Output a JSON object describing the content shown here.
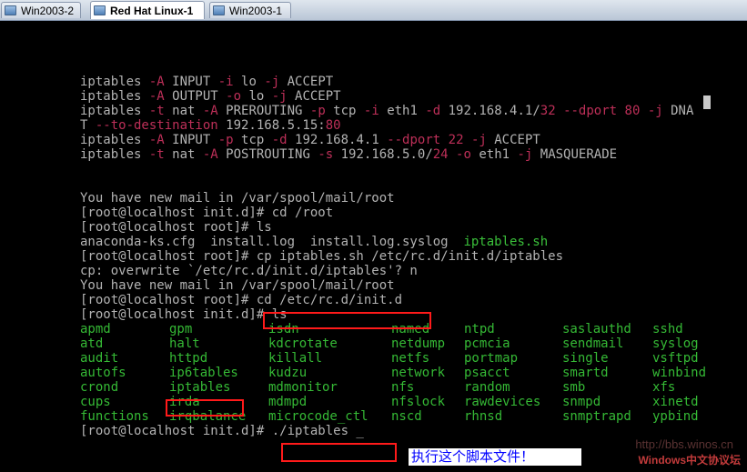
{
  "tabs": [
    {
      "label": "Win2003-2",
      "active": false
    },
    {
      "label": "Red Hat Linux-1",
      "active": true
    },
    {
      "label": "Win2003-1",
      "active": false
    }
  ],
  "colors": {
    "background": "#000000",
    "normal_text": "#b3b3b3",
    "option_text": "#bd2f58",
    "listing_text": "#35b935",
    "highlight_box": "#ff1a1a"
  },
  "terminal": {
    "lines": [
      [
        {
          "t": "iptables ",
          "c": ""
        },
        {
          "t": "-A",
          "c": "r"
        },
        {
          "t": " INPUT ",
          "c": ""
        },
        {
          "t": "-i",
          "c": "r"
        },
        {
          "t": " lo ",
          "c": ""
        },
        {
          "t": "-j",
          "c": "r"
        },
        {
          "t": " ACCEPT",
          "c": ""
        }
      ],
      [
        {
          "t": "iptables ",
          "c": ""
        },
        {
          "t": "-A",
          "c": "r"
        },
        {
          "t": " OUTPUT ",
          "c": ""
        },
        {
          "t": "-o",
          "c": "r"
        },
        {
          "t": " lo ",
          "c": ""
        },
        {
          "t": "-j",
          "c": "r"
        },
        {
          "t": " ACCEPT",
          "c": ""
        }
      ],
      [
        {
          "t": "iptables ",
          "c": ""
        },
        {
          "t": "-t",
          "c": "r"
        },
        {
          "t": " nat ",
          "c": ""
        },
        {
          "t": "-A",
          "c": "r"
        },
        {
          "t": " PREROUTING ",
          "c": ""
        },
        {
          "t": "-p",
          "c": "r"
        },
        {
          "t": " tcp ",
          "c": ""
        },
        {
          "t": "-i",
          "c": "r"
        },
        {
          "t": " eth1 ",
          "c": ""
        },
        {
          "t": "-d",
          "c": "r"
        },
        {
          "t": " 192.168.4.1/",
          "c": ""
        },
        {
          "t": "32",
          "c": "r"
        },
        {
          "t": " ",
          "c": ""
        },
        {
          "t": "--dport",
          "c": "r"
        },
        {
          "t": " ",
          "c": ""
        },
        {
          "t": "80",
          "c": "r"
        },
        {
          "t": " ",
          "c": ""
        },
        {
          "t": "-j",
          "c": "r"
        },
        {
          "t": " DNA",
          "c": ""
        }
      ],
      [
        {
          "t": "T ",
          "c": ""
        },
        {
          "t": "--to-destination",
          "c": "r"
        },
        {
          "t": " 192.168.5.15:",
          "c": ""
        },
        {
          "t": "80",
          "c": "r"
        }
      ],
      [
        {
          "t": "iptables ",
          "c": ""
        },
        {
          "t": "-A",
          "c": "r"
        },
        {
          "t": " INPUT ",
          "c": ""
        },
        {
          "t": "-p",
          "c": "r"
        },
        {
          "t": " tcp ",
          "c": ""
        },
        {
          "t": "-d",
          "c": "r"
        },
        {
          "t": " 192.168.4.1 ",
          "c": ""
        },
        {
          "t": "--dport",
          "c": "r"
        },
        {
          "t": " ",
          "c": ""
        },
        {
          "t": "22",
          "c": "r"
        },
        {
          "t": " ",
          "c": ""
        },
        {
          "t": "-j",
          "c": "r"
        },
        {
          "t": " ACCEPT",
          "c": ""
        }
      ],
      [
        {
          "t": "iptables ",
          "c": ""
        },
        {
          "t": "-t",
          "c": "r"
        },
        {
          "t": " nat ",
          "c": ""
        },
        {
          "t": "-A",
          "c": "r"
        },
        {
          "t": " POSTROUTING ",
          "c": ""
        },
        {
          "t": "-s",
          "c": "r"
        },
        {
          "t": " 192.168.5.0/",
          "c": ""
        },
        {
          "t": "24",
          "c": "r"
        },
        {
          "t": " ",
          "c": ""
        },
        {
          "t": "-o",
          "c": "r"
        },
        {
          "t": " eth1 ",
          "c": ""
        },
        {
          "t": "-j",
          "c": "r"
        },
        {
          "t": " MASQUERADE",
          "c": ""
        }
      ],
      [],
      [],
      [
        {
          "t": "You have new mail in /var/spool/mail/root",
          "c": ""
        }
      ],
      [
        {
          "t": "[root@localhost init.d]# cd /root",
          "c": ""
        }
      ],
      [
        {
          "t": "[root@localhost root]# ls",
          "c": ""
        }
      ],
      [
        {
          "t": "anaconda-ks.cfg  install.log  install.log.syslog  ",
          "c": ""
        },
        {
          "t": "iptables.sh",
          "c": "g"
        }
      ],
      [
        {
          "t": "[root@localhost root]# cp iptables.sh /etc/rc.d/init.d/iptables",
          "c": ""
        }
      ],
      [
        {
          "t": "cp: overwrite `/etc/rc.d/init.d/iptables'? n",
          "c": ""
        }
      ],
      [
        {
          "t": "You have new mail in /var/spool/mail/root",
          "c": ""
        }
      ],
      [
        {
          "t": "[root@localhost root]# cd /etc/rc.d/init.d",
          "c": ""
        }
      ],
      [
        {
          "t": "[root@localhost init.d]# ls",
          "c": ""
        }
      ],
      [],
      [],
      [],
      [],
      [],
      [],
      [],
      [
        {
          "t": "[root@localhost init.d]# ./iptables _",
          "c": ""
        }
      ]
    ],
    "ls_columns": [
      [
        "apmd",
        "atd",
        "audit",
        "autofs",
        "crond",
        "cups",
        "functions"
      ],
      [
        "gpm",
        "halt",
        "httpd",
        "ip6tables",
        "iptables",
        "irda",
        "irqbalance"
      ],
      [
        "isdn",
        "kdcrotate",
        "killall",
        "kudzu",
        "mdmonitor",
        "mdmpd",
        "microcode_ctl"
      ],
      [
        "named",
        "netdump",
        "netfs",
        "network",
        "nfs",
        "nfslock",
        "nscd"
      ],
      [
        "ntpd",
        "pcmcia",
        "portmap",
        "psacct",
        "random",
        "rawdevices",
        "rhnsd"
      ],
      [
        "saslauthd",
        "sendmail",
        "single",
        "smartd",
        "smb",
        "snmpd",
        "snmptrapd"
      ],
      [
        "sshd",
        "syslog",
        "vsftpd",
        "winbind",
        "xfs",
        "xinetd",
        "ypbind"
      ]
    ]
  },
  "annotation": {
    "text": "执行这个脚本文件！"
  },
  "watermark": {
    "url": "http://bbs.winos.cn",
    "site": "Windows中文协议坛"
  }
}
